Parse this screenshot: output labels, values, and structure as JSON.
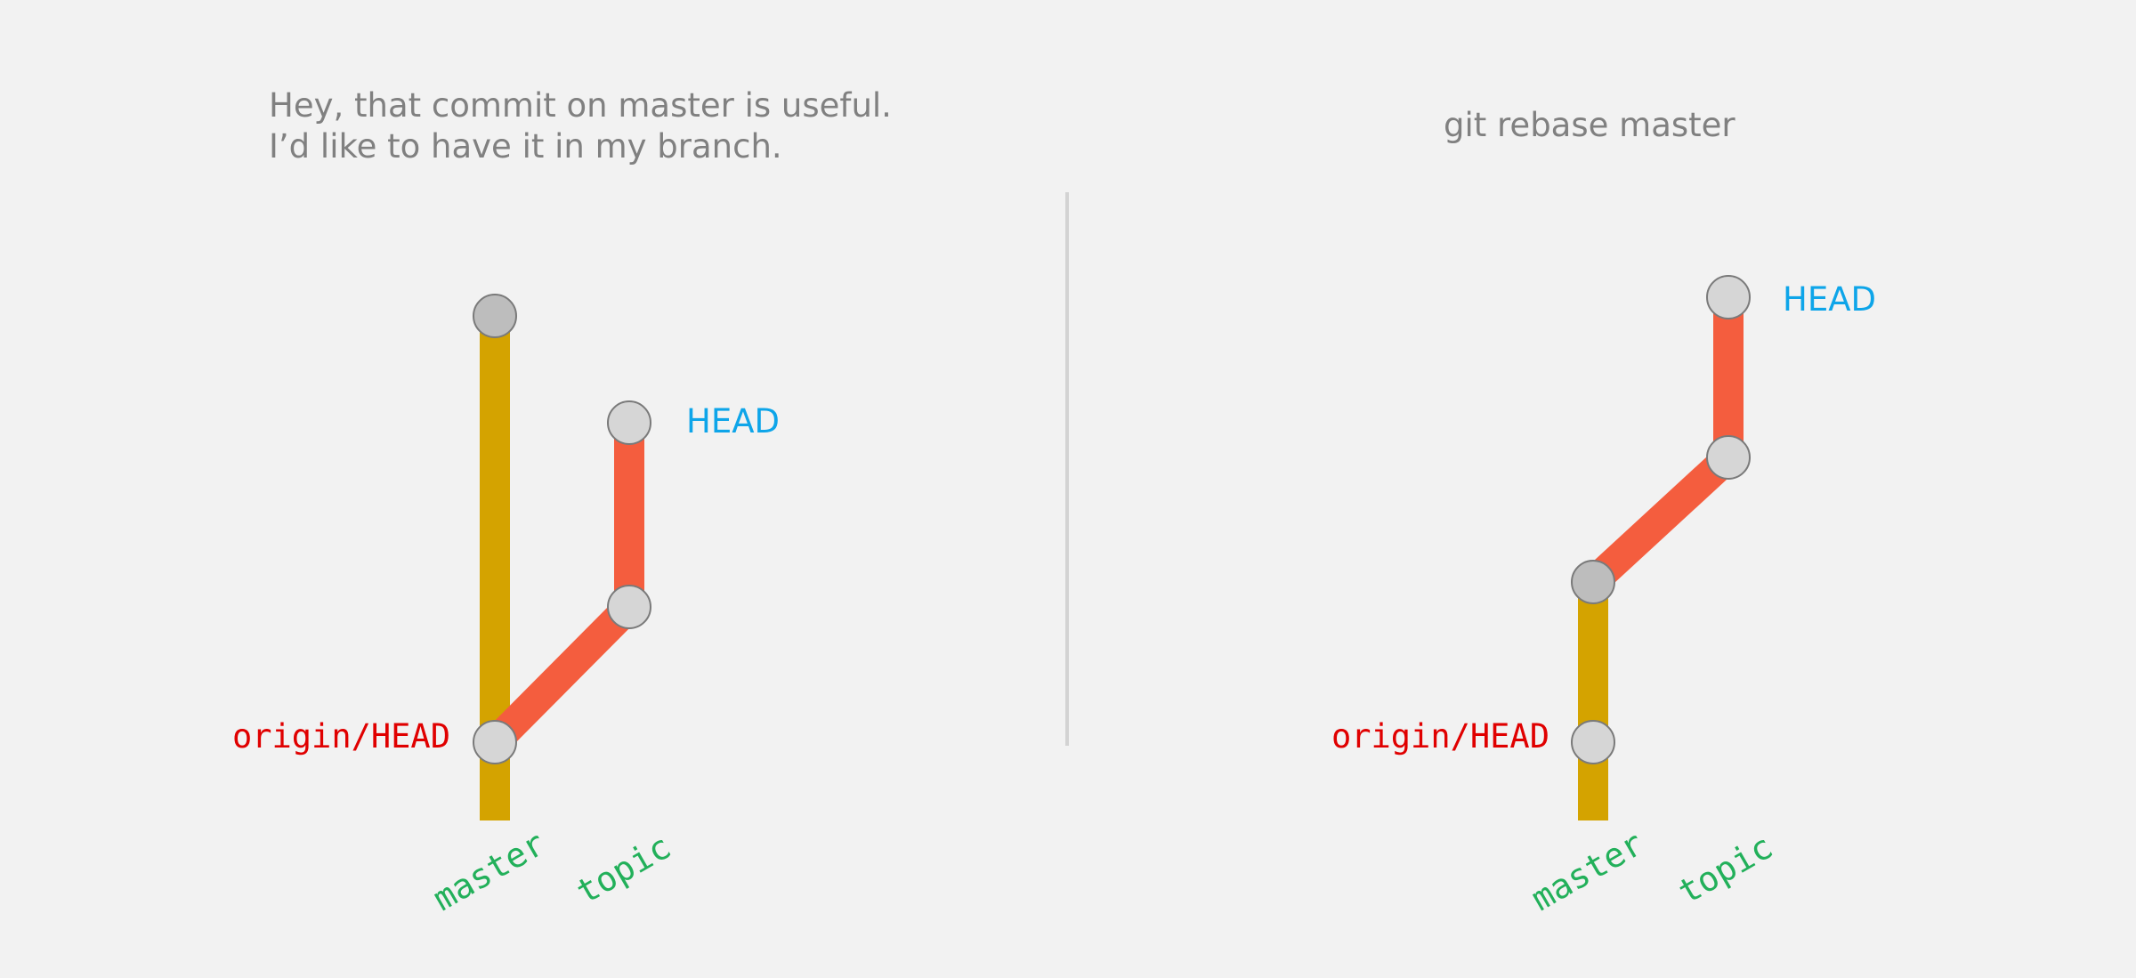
{
  "colors": {
    "background": "#f2f2f2",
    "master_lane": "#d4a300",
    "topic_lane": "#f45d3e",
    "commit_light": "#d6d6d6",
    "commit_dark": "#bdbdbd",
    "commit_outline": "#7a7a7a",
    "head_label": "#0ea5e9",
    "origin_label": "#e00000",
    "branch_label": "#22b05a",
    "caption": "#808080",
    "divider": "#d3d3d3"
  },
  "left_panel": {
    "caption_line1": "Hey, that commit on master is useful.",
    "caption_line2": "I’d like to have it in my branch.",
    "head_label": "HEAD",
    "origin_label": "origin/HEAD",
    "master_label": "master",
    "topic_label": "topic"
  },
  "right_panel": {
    "caption": "git rebase master",
    "head_label": "HEAD",
    "origin_label": "origin/HEAD",
    "master_label": "master",
    "topic_label": "topic"
  }
}
